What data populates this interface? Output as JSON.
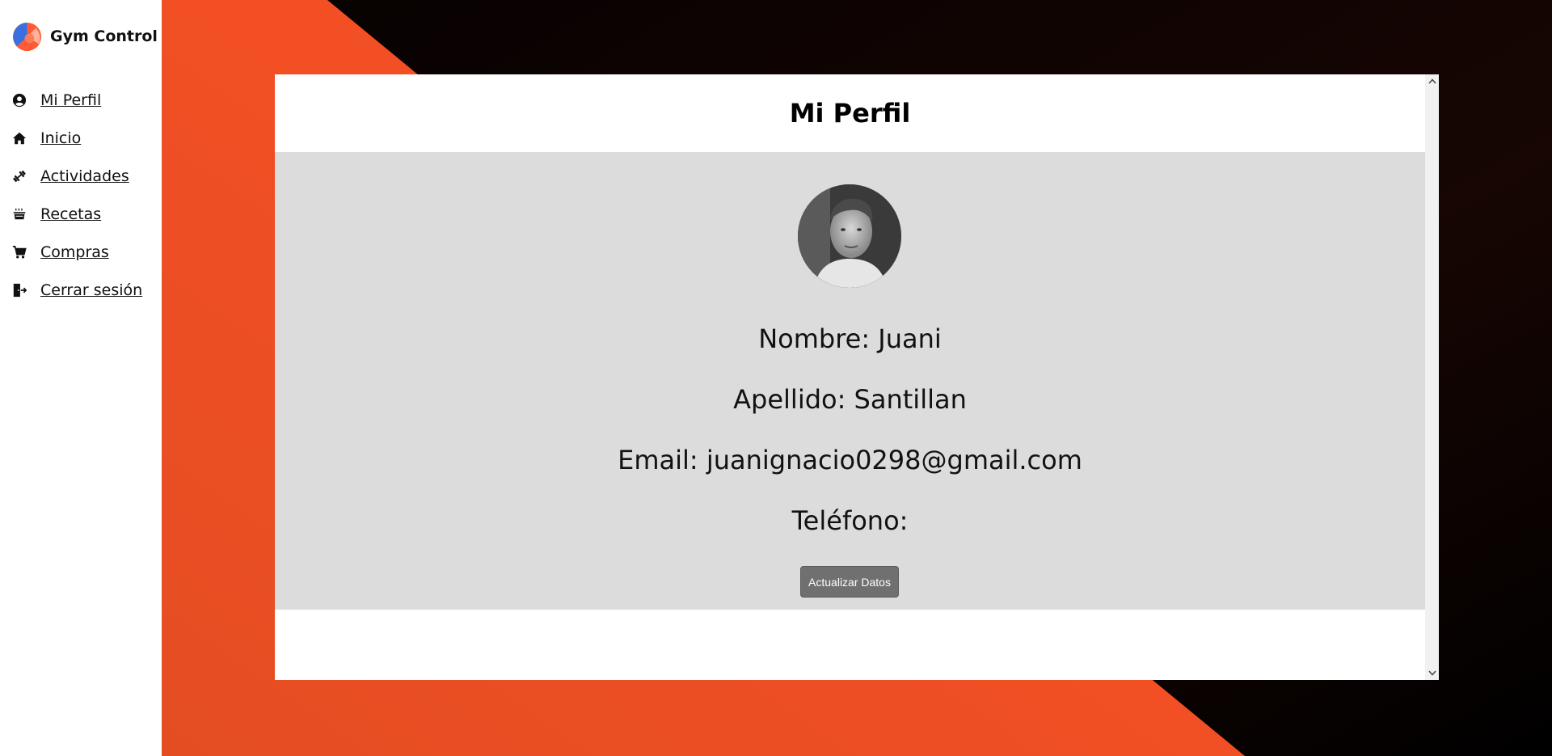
{
  "brand": {
    "name": "Gym Control",
    "logo_colors": [
      "#ff5a36",
      "#3a6fe0",
      "#ffb199"
    ]
  },
  "sidebar": {
    "items": [
      {
        "label": "Mi Perfil",
        "icon": "user-circle-icon"
      },
      {
        "label": "Inicio",
        "icon": "home-icon"
      },
      {
        "label": "Actividades",
        "icon": "dumbbell-icon"
      },
      {
        "label": "Recetas",
        "icon": "cooking-pot-icon"
      },
      {
        "label": "Compras",
        "icon": "shopping-cart-icon"
      },
      {
        "label": "Cerrar sesión",
        "icon": "logout-door-icon"
      }
    ]
  },
  "profile": {
    "title": "Mi Perfil",
    "nombre": "Nombre: Juani",
    "apellido": "Apellido: Santillan",
    "email": "Email: juanignacio0298@gmail.com",
    "telefono": "Teléfono:",
    "update_button": "Actualizar Datos"
  },
  "colors": {
    "accent_orange": "#ff5126",
    "background_dark": "#000000",
    "panel_gray": "#dcdcdc",
    "button_gray": "#707070"
  }
}
